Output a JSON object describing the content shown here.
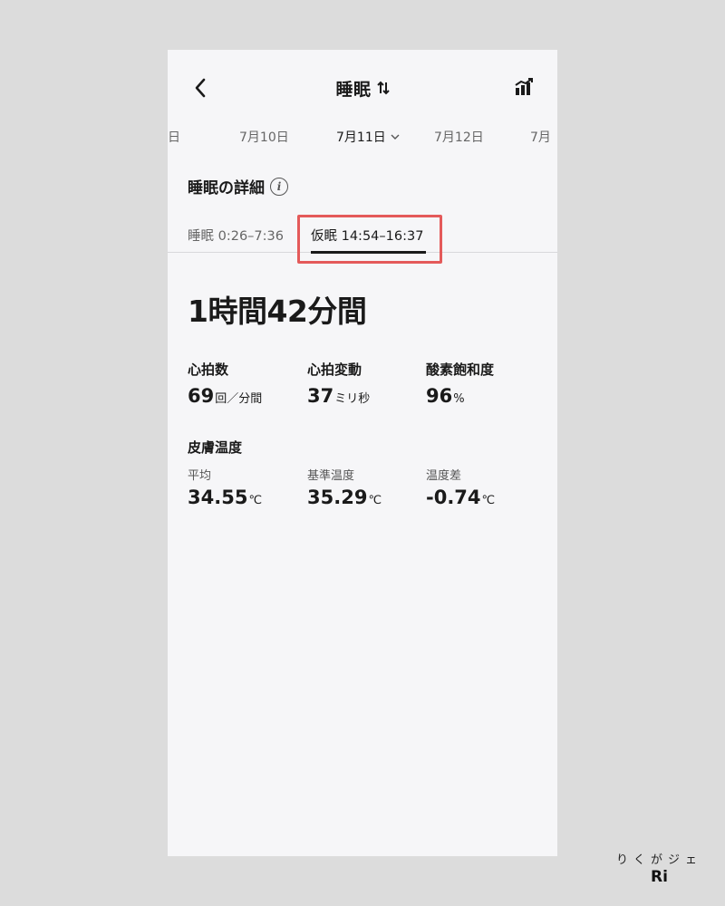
{
  "header": {
    "title": "睡眠",
    "back_icon": "chevron-left-icon",
    "sort_icon": "swap-vertical-icon",
    "chart_icon": "bar-chart-icon"
  },
  "dates": {
    "prev_partial": "日",
    "prev": "7月10日",
    "current": "7月11日",
    "next": "7月12日",
    "next_partial": "7月"
  },
  "details": {
    "title": "睡眠の詳細",
    "tabs": [
      {
        "label": "睡眠 0:26–7:36"
      },
      {
        "label": "仮眠 14:54–16:37"
      }
    ],
    "duration": "1時間42分間"
  },
  "metrics": {
    "heart_rate": {
      "label": "心拍数",
      "value": "69",
      "unit": "回／分間"
    },
    "hrv": {
      "label": "心拍変動",
      "value": "37",
      "unit": "ミリ秒"
    },
    "spo2": {
      "label": "酸素飽和度",
      "value": "96",
      "unit": "%"
    }
  },
  "skin_temp": {
    "title": "皮膚温度",
    "average": {
      "label": "平均",
      "value": "34.55",
      "unit": "℃"
    },
    "baseline": {
      "label": "基準温度",
      "value": "35.29",
      "unit": "℃"
    },
    "difference": {
      "label": "温度差",
      "value": "-0.74",
      "unit": "℃"
    }
  },
  "watermark": {
    "top": "りくがジェ",
    "bottom": "Ri"
  },
  "colors": {
    "highlight": "#e45a5a",
    "background": "#dcdcdc",
    "screen": "#f6f6f8"
  }
}
